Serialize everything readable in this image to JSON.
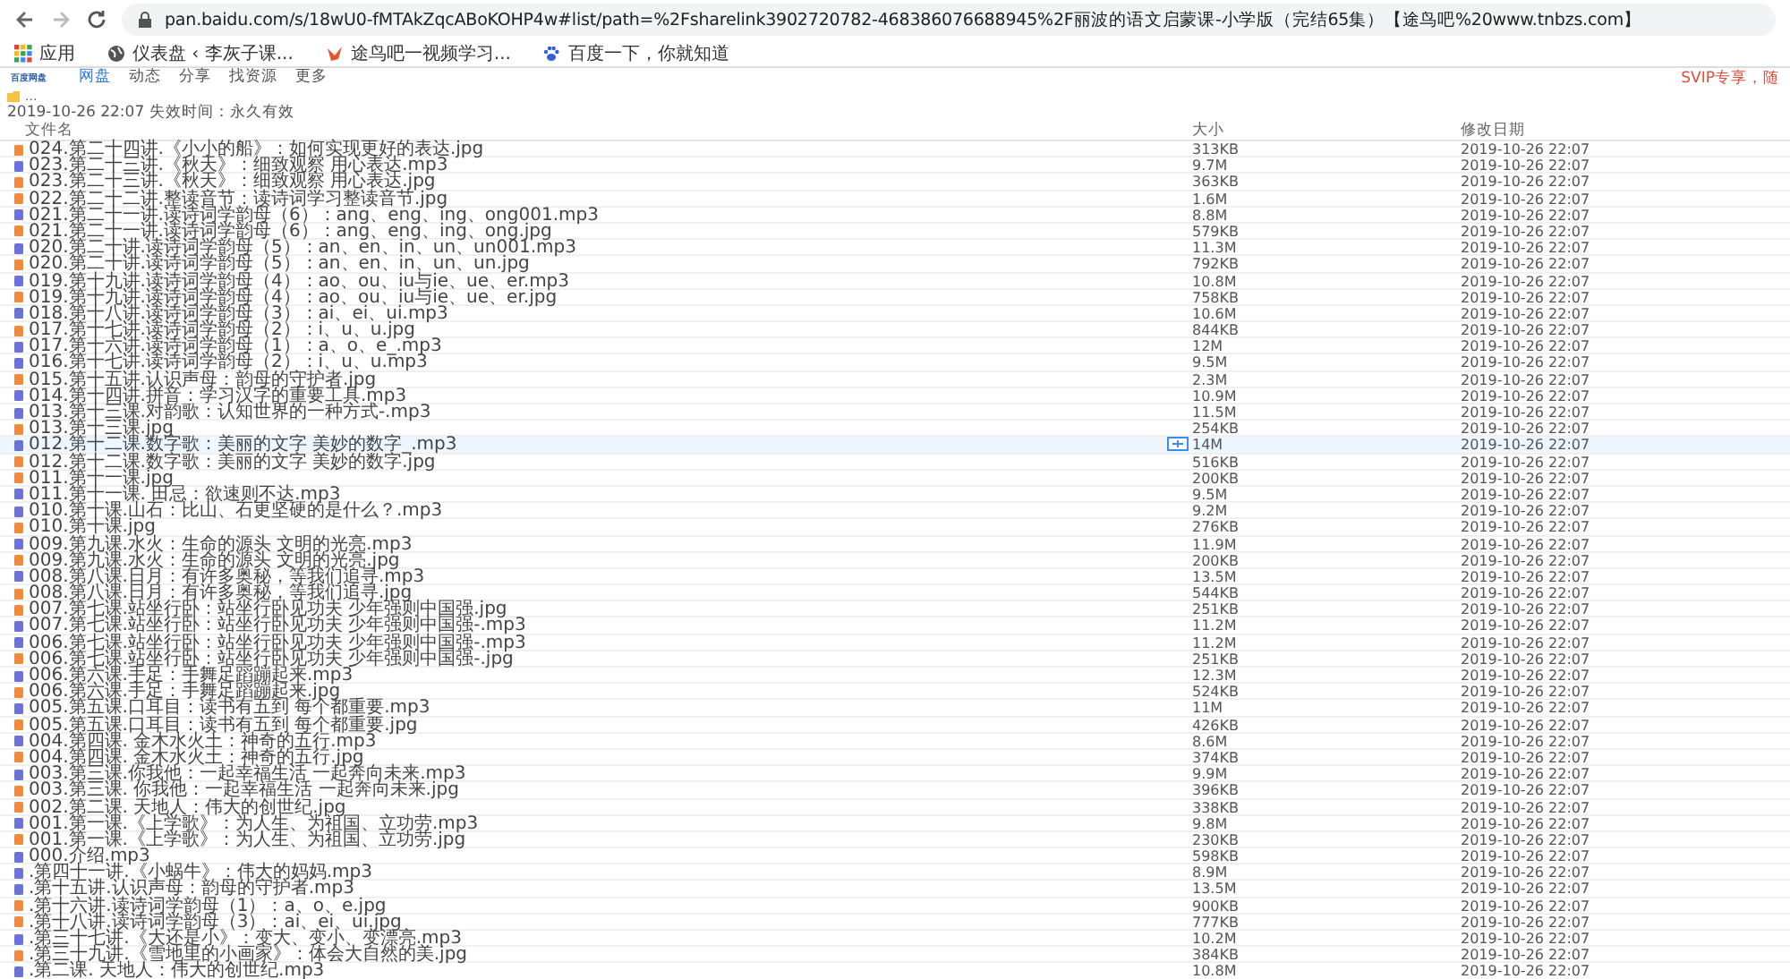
{
  "browser": {
    "url": "pan.baidu.com/s/18wU0-fMTAkZqcABoKOHP4w#list/path=%2Fsharelink3902720782-468386076688945%2F丽波的语文启蒙课-小学版（完结65集）【途鸟吧%20www.tnbzs.com】",
    "bookmarks": [
      {
        "label": "应用",
        "kind": "apps"
      },
      {
        "label": "仪表盘 ‹ 李灰子课...",
        "kind": "globe"
      },
      {
        "label": "途鸟吧一视频学习...",
        "kind": "bird"
      },
      {
        "label": "百度一下，你就知道",
        "kind": "paw"
      }
    ]
  },
  "site_nav": {
    "logo": "百度网盘",
    "items": [
      {
        "label": "网盘",
        "selected": true
      },
      {
        "label": "动态",
        "selected": false
      },
      {
        "label": "分享",
        "selected": false
      },
      {
        "label": "找资源",
        "selected": false
      },
      {
        "label": "更多",
        "selected": false
      }
    ],
    "promo": "SVIP专享，随"
  },
  "folder": {
    "title": "...",
    "share_info": "2019-10-26 22:07 失效时间：永久有效"
  },
  "table": {
    "columns": [
      "文件名",
      "大小",
      "修改日期"
    ],
    "rows": [
      {
        "name": "024.第二十四讲.《小小的船》：如何实现更好的表达.jpg",
        "kind": "image",
        "size": "313KB",
        "date": "2019-10-26 22:07",
        "highlighted": false
      },
      {
        "name": "023.第二十三讲.《秋天》：细致观察 用心表达.mp3",
        "kind": "audio",
        "size": "9.7M",
        "date": "2019-10-26 22:07",
        "highlighted": false
      },
      {
        "name": "023.第二十三讲.《秋天》：细致观察 用心表达.jpg",
        "kind": "image",
        "size": "363KB",
        "date": "2019-10-26 22:07",
        "highlighted": false
      },
      {
        "name": "022.第二十二讲.整读音节：读诗词学习整读音节.jpg",
        "kind": "image",
        "size": "1.6M",
        "date": "2019-10-26 22:07",
        "highlighted": false
      },
      {
        "name": "021.第二十一讲.读诗词学韵母（6）：ang、eng、ing、ong001.mp3",
        "kind": "audio",
        "size": "8.8M",
        "date": "2019-10-26 22:07",
        "highlighted": false
      },
      {
        "name": "021.第二十一讲.读诗词学韵母（6）：ang、eng、ing、ong.jpg",
        "kind": "image",
        "size": "579KB",
        "date": "2019-10-26 22:07",
        "highlighted": false
      },
      {
        "name": "020.第二十讲.读诗词学韵母（5）：an、en、in、un、un001.mp3",
        "kind": "audio",
        "size": "11.3M",
        "date": "2019-10-26 22:07",
        "highlighted": false
      },
      {
        "name": "020.第二十讲.读诗词学韵母（5）：an、en、in、un、un.jpg",
        "kind": "image",
        "size": "792KB",
        "date": "2019-10-26 22:07",
        "highlighted": false
      },
      {
        "name": "019.第十九讲.读诗词学韵母（4）：ao、ou、iu与ie、ue、er.mp3",
        "kind": "audio",
        "size": "10.8M",
        "date": "2019-10-26 22:07",
        "highlighted": false
      },
      {
        "name": "019.第十九讲.读诗词学韵母（4）：ao、ou、iu与ie、ue、er.jpg",
        "kind": "image",
        "size": "758KB",
        "date": "2019-10-26 22:07",
        "highlighted": false
      },
      {
        "name": "018.第十八讲.读诗词学韵母（3）：ai、ei、ui.mp3",
        "kind": "audio",
        "size": "10.6M",
        "date": "2019-10-26 22:07",
        "highlighted": false
      },
      {
        "name": "017.第十七讲.读诗词学韵母（2）：i、u、u.jpg",
        "kind": "image",
        "size": "844KB",
        "date": "2019-10-26 22:07",
        "highlighted": false
      },
      {
        "name": "017.第十六讲.读诗词学韵母（1）：a、o、e_.mp3",
        "kind": "audio",
        "size": "12M",
        "date": "2019-10-26 22:07",
        "highlighted": false
      },
      {
        "name": "016.第十七讲.读诗词学韵母（2）：i、u、u.mp3",
        "kind": "audio",
        "size": "9.5M",
        "date": "2019-10-26 22:07",
        "highlighted": false
      },
      {
        "name": "015.第十五讲.认识声母：韵母的守护者.jpg",
        "kind": "image",
        "size": "2.3M",
        "date": "2019-10-26 22:07",
        "highlighted": false
      },
      {
        "name": "014.第十四讲.拼音：学习汉字的重要工具.mp3",
        "kind": "audio",
        "size": "10.9M",
        "date": "2019-10-26 22:07",
        "highlighted": false
      },
      {
        "name": "013.第十三课.对韵歌：认知世界的一种方式-.mp3",
        "kind": "audio",
        "size": "11.5M",
        "date": "2019-10-26 22:07",
        "highlighted": false
      },
      {
        "name": "013.第十三课.jpg",
        "kind": "image",
        "size": "254KB",
        "date": "2019-10-26 22:07",
        "highlighted": false
      },
      {
        "name": "012.第十二课.数字歌：美丽的文字 美妙的数字_.mp3",
        "kind": "audio",
        "size": "14M",
        "date": "2019-10-26 22:07",
        "highlighted": true
      },
      {
        "name": "012.第十二课.数字歌：美丽的文字 美妙的数字.jpg",
        "kind": "image",
        "size": "516KB",
        "date": "2019-10-26 22:07",
        "highlighted": false
      },
      {
        "name": "011.第十一课.jpg",
        "kind": "image",
        "size": "200KB",
        "date": "2019-10-26 22:07",
        "highlighted": false
      },
      {
        "name": "011.第十一课. 田忌：欲速则不达.mp3",
        "kind": "audio",
        "size": "9.5M",
        "date": "2019-10-26 22:07",
        "highlighted": false
      },
      {
        "name": "010.第十课.山石：比山、石更坚硬的是什么？.mp3",
        "kind": "audio",
        "size": "9.2M",
        "date": "2019-10-26 22:07",
        "highlighted": false
      },
      {
        "name": "010.第十课.jpg",
        "kind": "image",
        "size": "276KB",
        "date": "2019-10-26 22:07",
        "highlighted": false
      },
      {
        "name": "009.第九课.水火：生命的源头 文明的光亮.mp3",
        "kind": "audio",
        "size": "11.9M",
        "date": "2019-10-26 22:07",
        "highlighted": false
      },
      {
        "name": "009.第九课.水火：生命的源头 文明的光亮.jpg",
        "kind": "image",
        "size": "200KB",
        "date": "2019-10-26 22:07",
        "highlighted": false
      },
      {
        "name": "008.第八课.日月：有许多奥秘，等我们追寻.mp3",
        "kind": "audio",
        "size": "13.5M",
        "date": "2019-10-26 22:07",
        "highlighted": false
      },
      {
        "name": "008.第八课.日月：有许多奥秘，等我们追寻.jpg",
        "kind": "image",
        "size": "544KB",
        "date": "2019-10-26 22:07",
        "highlighted": false
      },
      {
        "name": "007.第七课.站坐行卧：站坐行卧见功夫 少年强则中国强.jpg",
        "kind": "image",
        "size": "251KB",
        "date": "2019-10-26 22:07",
        "highlighted": false
      },
      {
        "name": "007.第七课.站坐行卧：站坐行卧见功夫 少年强则中国强-.mp3",
        "kind": "audio",
        "size": "11.2M",
        "date": "2019-10-26 22:07",
        "highlighted": false
      },
      {
        "name": "006.第七课.站坐行卧：站坐行卧见功夫 少年强则中国强-.mp3",
        "kind": "audio",
        "size": "11.2M",
        "date": "2019-10-26 22:07",
        "highlighted": false
      },
      {
        "name": "006.第七课.站坐行卧：站坐行卧见功夫 少年强则中国强-.jpg",
        "kind": "image",
        "size": "251KB",
        "date": "2019-10-26 22:07",
        "highlighted": false
      },
      {
        "name": "006.第六课.手足：手舞足蹈蹦起来.mp3",
        "kind": "audio",
        "size": "12.3M",
        "date": "2019-10-26 22:07",
        "highlighted": false
      },
      {
        "name": "006.第六课.手足：手舞足蹈蹦起来.jpg",
        "kind": "image",
        "size": "524KB",
        "date": "2019-10-26 22:07",
        "highlighted": false
      },
      {
        "name": "005.第五课.口耳目：读书有五到 每个都重要.mp3",
        "kind": "audio",
        "size": "11M",
        "date": "2019-10-26 22:07",
        "highlighted": false
      },
      {
        "name": "005.第五课.口耳目：读书有五到 每个都重要.jpg",
        "kind": "image",
        "size": "426KB",
        "date": "2019-10-26 22:07",
        "highlighted": false
      },
      {
        "name": "004.第四课. 金木水火土：神奇的五行.mp3",
        "kind": "audio",
        "size": "8.6M",
        "date": "2019-10-26 22:07",
        "highlighted": false
      },
      {
        "name": "004.第四课. 金木水火土：神奇的五行.jpg",
        "kind": "image",
        "size": "374KB",
        "date": "2019-10-26 22:07",
        "highlighted": false
      },
      {
        "name": "003.第三课.你我他：一起幸福生活 一起奔向未来.mp3",
        "kind": "audio",
        "size": "9.9M",
        "date": "2019-10-26 22:07",
        "highlighted": false
      },
      {
        "name": "003.第三课. 你我他：一起幸福生活 一起奔向未来.jpg",
        "kind": "image",
        "size": "396KB",
        "date": "2019-10-26 22:07",
        "highlighted": false
      },
      {
        "name": "002.第二课. 天地人：伟大的创世纪.jpg",
        "kind": "image",
        "size": "338KB",
        "date": "2019-10-26 22:07",
        "highlighted": false
      },
      {
        "name": "001.第一课.《上学歌》：为人生、为祖国、立功劳.mp3",
        "kind": "audio",
        "size": "9.8M",
        "date": "2019-10-26 22:07",
        "highlighted": false
      },
      {
        "name": "001.第一课.《上学歌》：为人生、为祖国、立功劳.jpg",
        "kind": "image",
        "size": "230KB",
        "date": "2019-10-26 22:07",
        "highlighted": false
      },
      {
        "name": "000.介绍.mp3",
        "kind": "audio",
        "size": "598KB",
        "date": "2019-10-26 22:07",
        "highlighted": false
      },
      {
        "name": ".第四十一讲.《小蜗牛》：伟大的妈妈.mp3",
        "kind": "audio",
        "size": "8.9M",
        "date": "2019-10-26 22:07",
        "highlighted": false
      },
      {
        "name": ".第十五讲.认识声母：韵母的守护者.mp3",
        "kind": "audio",
        "size": "13.5M",
        "date": "2019-10-26 22:07",
        "highlighted": false
      },
      {
        "name": ".第十六讲.读诗词学韵母（1）：a、o、e.jpg",
        "kind": "image",
        "size": "900KB",
        "date": "2019-10-26 22:07",
        "highlighted": false
      },
      {
        "name": ".第十八讲.读诗词学韵母（3）：ai、ei、ui.jpg",
        "kind": "image",
        "size": "777KB",
        "date": "2019-10-26 22:07",
        "highlighted": false
      },
      {
        "name": ".第三十七讲.《大还是小》：变大、变小、变漂亮.mp3",
        "kind": "audio",
        "size": "10.2M",
        "date": "2019-10-26 22:07",
        "highlighted": false
      },
      {
        "name": ".第三十九讲.《雪地里的小画家》：体会大自然的美.jpg",
        "kind": "image",
        "size": "384KB",
        "date": "2019-10-26 22:07",
        "highlighted": false
      },
      {
        "name": ".第二课. 天地人：伟大的创世纪.mp3",
        "kind": "audio",
        "size": "10.8M",
        "date": "2019-10-26 22:07",
        "highlighted": false
      }
    ]
  }
}
